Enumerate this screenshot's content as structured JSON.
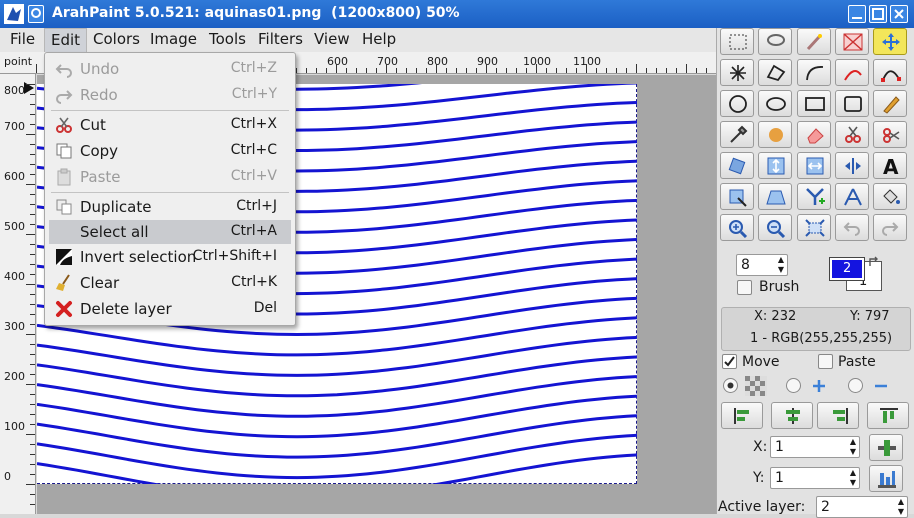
{
  "window": {
    "title": "ArahPaint 5.0.521: aquinas01.png  (1200x800) 50%"
  },
  "menubar": {
    "items": [
      "File",
      "Edit",
      "Colors",
      "Image",
      "Tools",
      "Filters",
      "View",
      "Help"
    ]
  },
  "ruler": {
    "corner_label": "point",
    "h_labels": [
      "600",
      "700",
      "800",
      "900",
      "1000",
      "1100"
    ],
    "v_labels": [
      "800",
      "700",
      "600",
      "500",
      "400",
      "300",
      "200",
      "100",
      "0"
    ]
  },
  "edit_menu": {
    "items": [
      {
        "label": "Undo",
        "shortcut": "Ctrl+Z",
        "icon": "undo-icon",
        "enabled": false
      },
      {
        "label": "Redo",
        "shortcut": "Ctrl+Y",
        "icon": "redo-icon",
        "enabled": false
      },
      {
        "label": "Cut",
        "shortcut": "Ctrl+X",
        "icon": "scissors-icon",
        "enabled": true
      },
      {
        "label": "Copy",
        "shortcut": "Ctrl+C",
        "icon": "copy-icon",
        "enabled": true
      },
      {
        "label": "Paste",
        "shortcut": "Ctrl+V",
        "icon": "paste-icon",
        "enabled": false
      },
      {
        "label": "Duplicate",
        "shortcut": "Ctrl+J",
        "icon": "duplicate-icon",
        "enabled": true
      },
      {
        "label": "Select all",
        "shortcut": "Ctrl+A",
        "icon": "",
        "enabled": true,
        "highlighted": true
      },
      {
        "label": "Invert selection",
        "shortcut": "Ctrl+Shift+I",
        "icon": "invert-icon",
        "enabled": true
      },
      {
        "label": "Clear",
        "shortcut": "Ctrl+K",
        "icon": "broom-icon",
        "enabled": true
      },
      {
        "label": "Delete layer",
        "shortcut": "Del",
        "icon": "delete-icon",
        "enabled": true
      }
    ]
  },
  "tools": {
    "icons": [
      "rect-select-icon",
      "lasso-icon",
      "magic-wand-icon",
      "crop-icon",
      "move-tool-icon",
      "starburst-icon",
      "polygon-lasso-icon",
      "curve-icon",
      "bezier-red-icon",
      "bezier-path-icon",
      "ellipse-icon",
      "oval-icon",
      "rectangle-icon",
      "rounded-rect-icon",
      "pencil-icon",
      "eyedropper-icon",
      "gradient-icon",
      "eraser-icon",
      "clone-scissors-icon",
      "heal-icon",
      "rotate-icon",
      "flip-vertical-icon",
      "flip-horizontal-icon",
      "mirror-icon",
      "text-tool-icon",
      "transform-icon",
      "perspective-icon",
      "merge-icon",
      "warp-icon",
      "fill-bucket-icon",
      "zoom-in-icon",
      "zoom-out-icon",
      "zoom-fit-icon",
      "undo-tool-icon",
      "redo-tool-icon"
    ],
    "selected_index": 4,
    "brush_size": "8",
    "brush_label": "Brush",
    "primary_color": "2",
    "secondary_color": "1",
    "primary_color_hex": "#1414e0",
    "coord_x": "X: 232",
    "coord_y": "Y: 797",
    "color_readout": "1 - RGB(255,255,255)",
    "move_label": "Move",
    "paste_label": "Paste",
    "x_label": "X:",
    "x_value": "1",
    "y_label": "Y:",
    "y_value": "1",
    "active_layer_label": "Active layer:",
    "active_layer_value": "2"
  },
  "colors": {
    "wave": "#1414d2",
    "titlebar": "#2568cf"
  }
}
